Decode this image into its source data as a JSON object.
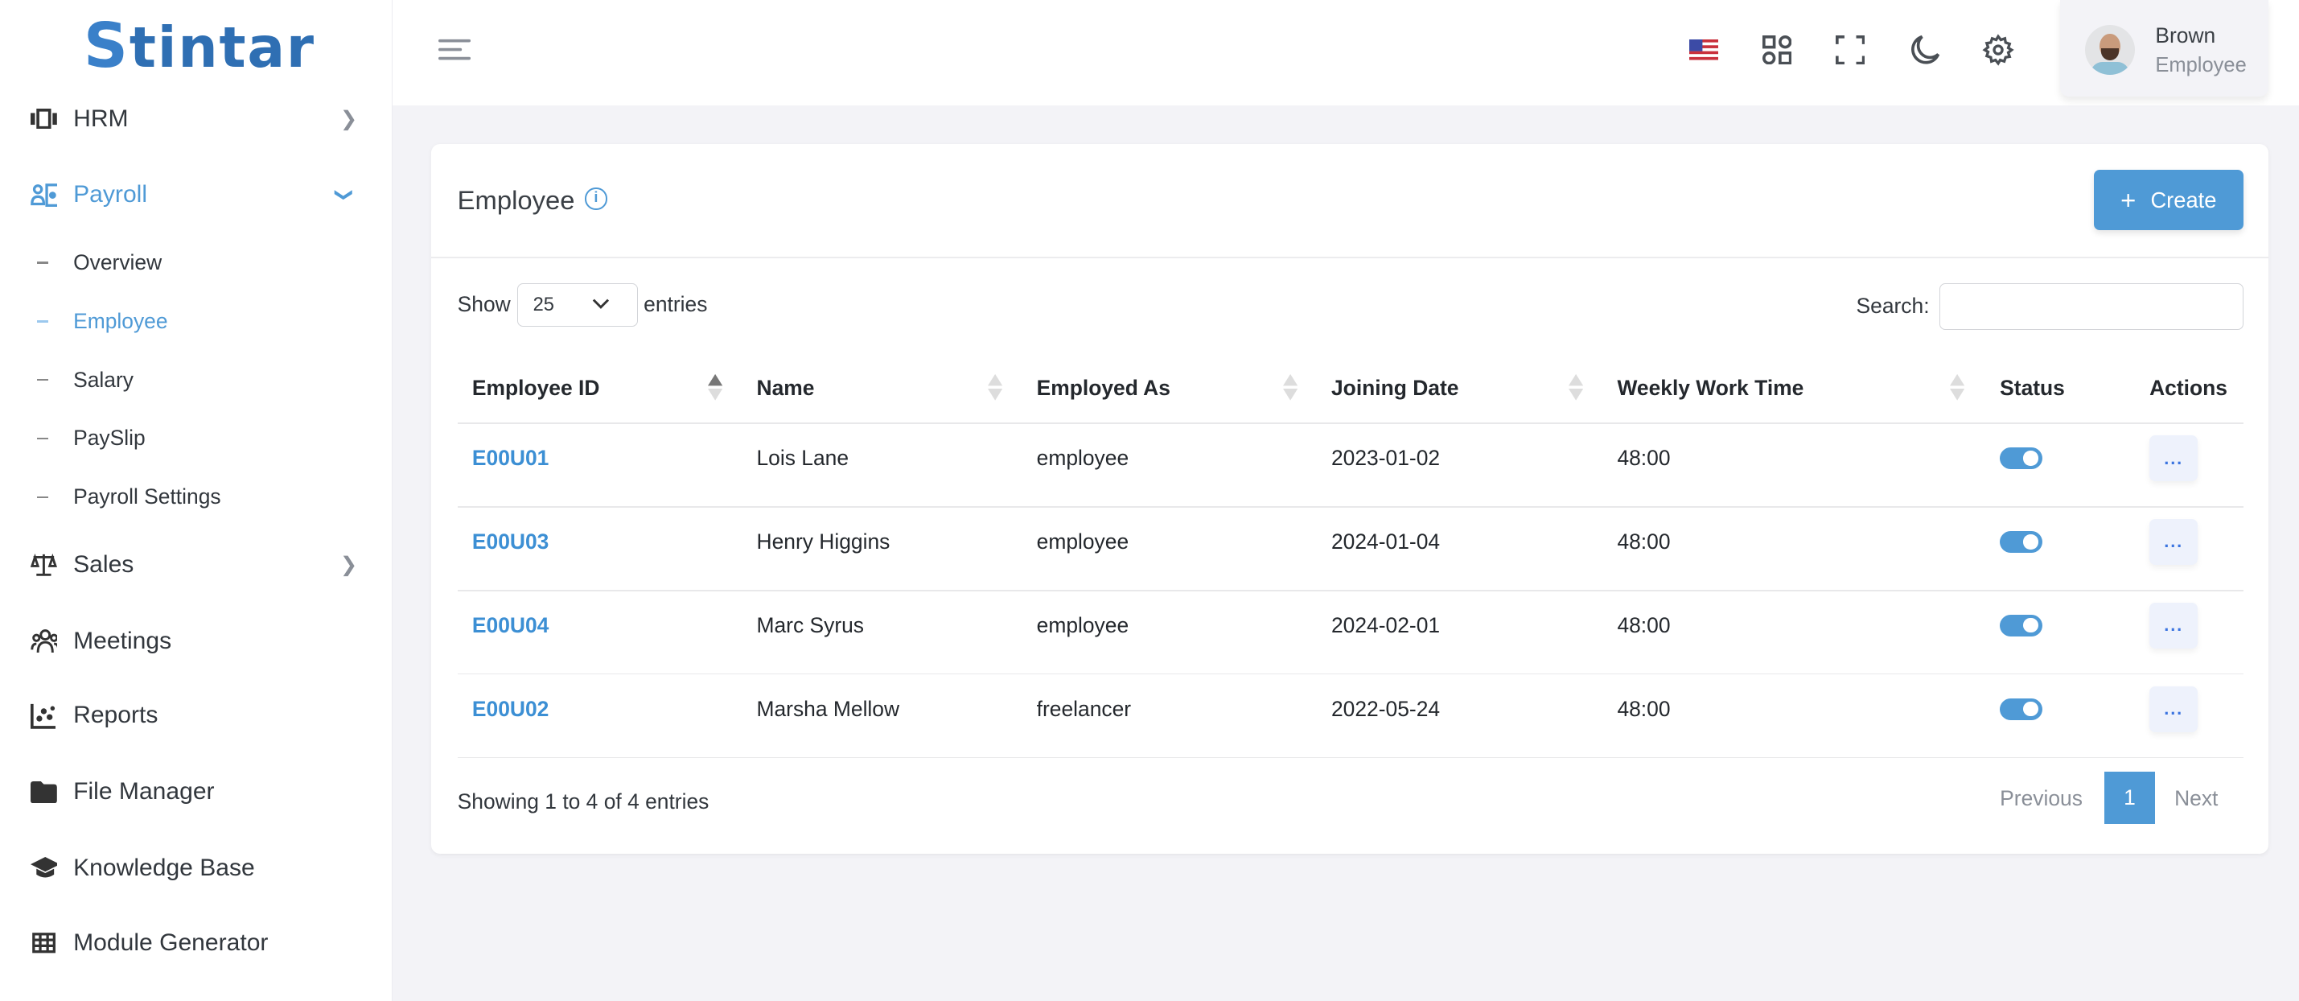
{
  "brand": {
    "logo_text": "Stintar",
    "accent": "#4f9ad6"
  },
  "sidebar": {
    "items": [
      {
        "label": "HRM",
        "icon": "hrm-icon",
        "has_chevron": true
      },
      {
        "label": "Payroll",
        "icon": "payroll-icon",
        "expanded": true,
        "active": true
      },
      {
        "label": "Sales",
        "icon": "scale-icon",
        "has_chevron": true
      },
      {
        "label": "Meetings",
        "icon": "people-icon"
      },
      {
        "label": "Reports",
        "icon": "chart-icon"
      },
      {
        "label": "File Manager",
        "icon": "folder-icon"
      },
      {
        "label": "Knowledge Base",
        "icon": "graduation-cap-icon"
      },
      {
        "label": "Module Generator",
        "icon": "grid-icon"
      }
    ],
    "payroll_sub": [
      {
        "label": "Overview"
      },
      {
        "label": "Employee",
        "active": true
      },
      {
        "label": "Salary"
      },
      {
        "label": "PaySlip"
      },
      {
        "label": "Payroll Settings"
      }
    ]
  },
  "topbar": {
    "icons": [
      "menu-icon",
      "us-flag-icon",
      "apps-icon",
      "fullscreen-icon",
      "moon-icon",
      "gear-icon"
    ],
    "user": {
      "name": "Brown",
      "role": "Employee"
    }
  },
  "page": {
    "title": "Employee",
    "create_label": "Create",
    "show_label": "Show",
    "entries_value": "25",
    "entries_label": "entries",
    "search_label": "Search:",
    "search_value": "",
    "columns": [
      "Employee ID",
      "Name",
      "Employed As",
      "Joining Date",
      "Weekly Work Time",
      "Status",
      "Actions"
    ],
    "rows": [
      {
        "id": "E00U01",
        "name": "Lois Lane",
        "role": "employee",
        "date": "2023-01-02",
        "time": "48:00",
        "status": true
      },
      {
        "id": "E00U03",
        "name": "Henry Higgins",
        "role": "employee",
        "date": "2024-01-04",
        "time": "48:00",
        "status": true
      },
      {
        "id": "E00U04",
        "name": "Marc Syrus",
        "role": "employee",
        "date": "2024-02-01",
        "time": "48:00",
        "status": true
      },
      {
        "id": "E00U02",
        "name": "Marsha Mellow",
        "role": "freelancer",
        "date": "2022-05-24",
        "time": "48:00",
        "status": true
      }
    ],
    "actions_label": "...",
    "info": "Showing 1 to 4 of 4 entries",
    "pagination": {
      "previous": "Previous",
      "current": "1",
      "next": "Next"
    }
  }
}
